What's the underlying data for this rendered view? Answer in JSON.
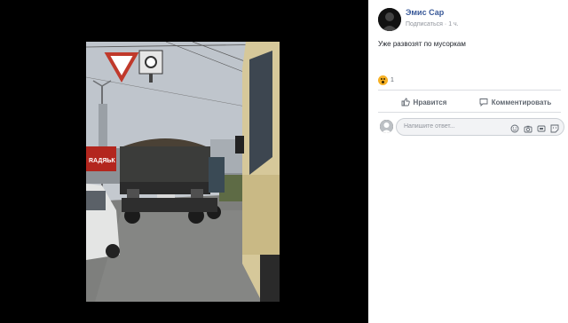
{
  "post": {
    "author": "Эмис Сар",
    "follow_label": "Подписаться",
    "separator": " · ",
    "time": "1 ч.",
    "text": "Уже развозят по мусоркам"
  },
  "reactions": {
    "icon": "wow-emoji-icon",
    "count": "1"
  },
  "actions": {
    "like_label": "Нравится",
    "comment_label": "Комментировать"
  },
  "comment_input": {
    "placeholder": "Напишите ответ..."
  },
  "photo": {
    "sign_text": "RАДЯЬК"
  },
  "colors": {
    "link": "#385898",
    "background": "#000000",
    "panel": "#ffffff"
  }
}
